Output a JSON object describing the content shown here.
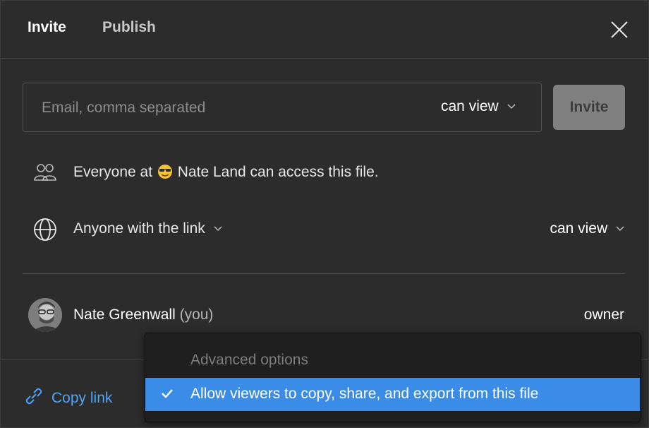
{
  "tabs": {
    "invite": "Invite",
    "publish": "Publish"
  },
  "invite_form": {
    "email_placeholder": "Email, comma separated",
    "email_value": "",
    "permission": "can view",
    "invite_button": "Invite"
  },
  "team_access": {
    "prefix": "Everyone at",
    "team": "Nate Land",
    "suffix": "can access this file."
  },
  "link_access": {
    "scope": "Anyone with the link",
    "permission": "can view"
  },
  "members": [
    {
      "name": "Nate Greenwall",
      "you_label": "(you)",
      "role": "owner"
    }
  ],
  "footer": {
    "copy_link": "Copy link"
  },
  "dropdown": {
    "header": "Advanced options",
    "items": [
      {
        "label": "Allow viewers to copy, share, and export from this file",
        "checked": true
      }
    ]
  },
  "icons": {
    "close": "close-icon",
    "team": "users-icon",
    "link": "globe-icon",
    "copy": "link-icon",
    "check": "check-icon",
    "emoji": "sunglasses-emoji-icon"
  },
  "colors": {
    "background": "#2c2c2c",
    "accent_blue": "#3b8ce6",
    "link_blue": "#4fa3f7",
    "menu_bg": "#1f1f1f",
    "disabled_button": "#808080"
  }
}
